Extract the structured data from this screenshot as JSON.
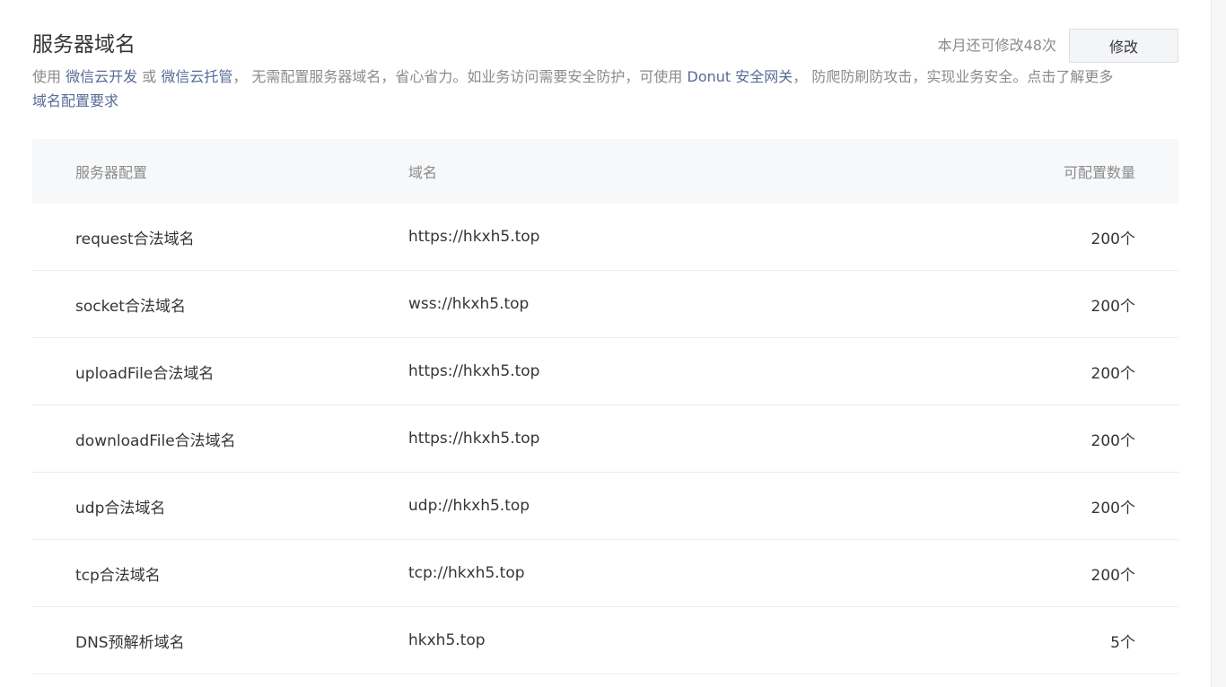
{
  "header": {
    "title": "服务器域名",
    "quota_text": "本月还可修改48次",
    "edit_label": "修改"
  },
  "description": {
    "prefix": "使用",
    "link_cloud_dev": "微信云开发",
    "or": " 或 ",
    "link_cloud_host": "微信云托管",
    "middle": "， 无需配置服务器域名，省心省力。如业务访问需要安全防护，可使用 ",
    "link_donut": "Donut 安全网关",
    "suffix": "， 防爬防刷防攻击，实现业务安全。点击了解更多",
    "link_requirements": "域名配置要求"
  },
  "table": {
    "headers": {
      "config": "服务器配置",
      "domain": "域名",
      "count": "可配置数量"
    },
    "rows": [
      {
        "config": "request合法域名",
        "domain": "https://hkxh5.top",
        "count": "200个"
      },
      {
        "config": "socket合法域名",
        "domain": "wss://hkxh5.top",
        "count": "200个"
      },
      {
        "config": "uploadFile合法域名",
        "domain": "https://hkxh5.top",
        "count": "200个"
      },
      {
        "config": "downloadFile合法域名",
        "domain": "https://hkxh5.top",
        "count": "200个"
      },
      {
        "config": "udp合法域名",
        "domain": "udp://hkxh5.top",
        "count": "200个"
      },
      {
        "config": "tcp合法域名",
        "domain": "tcp://hkxh5.top",
        "count": "200个"
      },
      {
        "config": "DNS预解析域名",
        "domain": "hkxh5.top",
        "count": "5个"
      }
    ]
  },
  "colors": {
    "link": "#576b95",
    "muted": "#8b8b8b",
    "text": "#353535",
    "header_bg": "#f7f8fa"
  }
}
